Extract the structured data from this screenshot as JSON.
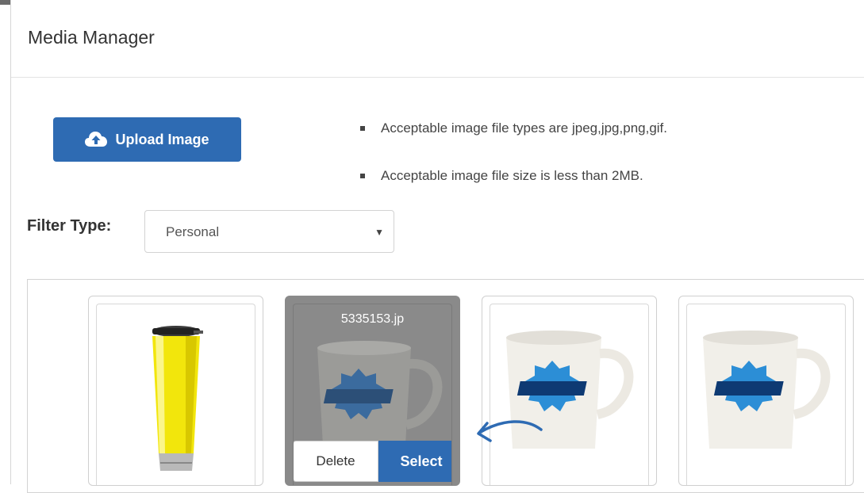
{
  "modal": {
    "title": "Media Manager"
  },
  "upload": {
    "label": "Upload Image",
    "icon": "cloud-upload-icon"
  },
  "rules": [
    "Acceptable image file types are jpeg,jpg,png,gif.",
    "Acceptable image file size is less than 2MB."
  ],
  "filter": {
    "label": "Filter Type:",
    "selected": "Personal"
  },
  "gallery": {
    "hovered_filename": "5335153.jp",
    "delete_label": "Delete",
    "select_label": "Select"
  },
  "colors": {
    "primary": "#2e6bb3",
    "hover_overlay": "#8a8a8a"
  }
}
